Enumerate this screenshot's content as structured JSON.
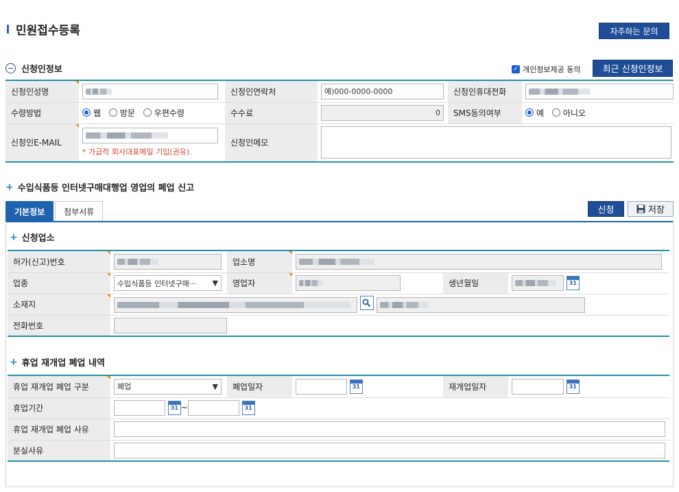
{
  "page": {
    "title": "민원접수등록",
    "faq_button": "자주하는 문의"
  },
  "applicant": {
    "section_title": "신청인정보",
    "privacy_consent": "개인정보제공 동의",
    "recent_button": "최근 신청인정보",
    "labels": {
      "name": "신청인성명",
      "contact": "신청인연락처",
      "mobile": "신청인휴대전화",
      "receive_method": "수령방법",
      "fee": "수수료",
      "sms": "SMS동의여부",
      "email": "신청인E-MAIL",
      "memo": "신청인메모"
    },
    "contact_placeholder": "예)000-0000-0000",
    "fee_value": "0",
    "receive_options": [
      "웹",
      "방문",
      "우편수령"
    ],
    "sms_options": [
      "예",
      "아니오"
    ],
    "email_note": "* 가급적 회사대표메일 기입(권유)."
  },
  "form": {
    "title": "수입식품등 인터넷구매대행업 영업의 폐업 신고",
    "tabs": [
      "기본정보",
      "첨부서류"
    ],
    "apply_button": "신청",
    "save_button": "저장",
    "business": {
      "section_title": "신청업소",
      "labels": {
        "license_no": "허가(신고)번호",
        "business_name": "업소명",
        "industry": "업종",
        "operator": "영업자",
        "birth": "생년월일",
        "address": "소재지",
        "phone": "전화번호"
      },
      "industry_value": "수입식품등 인터넷구매···"
    },
    "closure": {
      "section_title": "휴업 재개업 폐업 내역",
      "labels": {
        "type": "휴업 재개업 폐업 구분",
        "close_date": "폐업일자",
        "reopen_date": "재개업일자",
        "period": "휴업기간",
        "reason": "휴업 재개업 폐업 사유",
        "lost_reason": "분실사유"
      },
      "type_value": "폐업",
      "tilde": "~",
      "cal_day": "31"
    }
  }
}
